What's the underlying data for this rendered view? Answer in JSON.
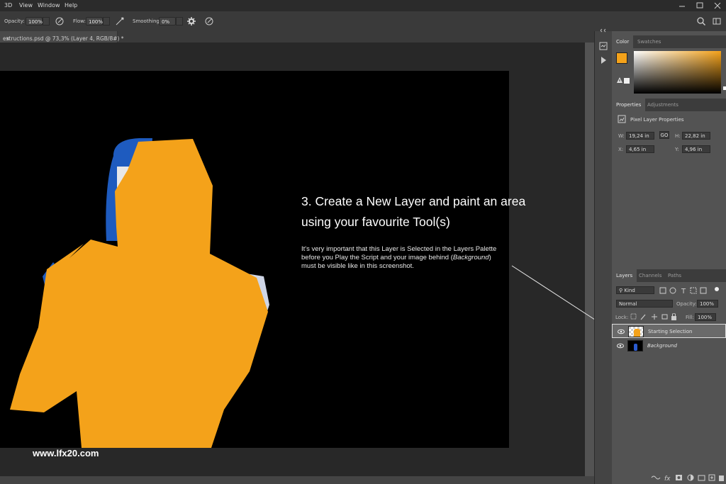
{
  "menubar": {
    "items": [
      "3D",
      "View",
      "Window",
      "Help"
    ]
  },
  "options": {
    "opacity_label": "Opacity:",
    "opacity_value": "100%",
    "flow_label": "Flow:",
    "flow_value": "100%",
    "smoothing_label": "Smoothing:",
    "smoothing_value": "0%"
  },
  "document": {
    "tab_title": "estructions.psd @ 73,3% (Layer 4, RGB/8#) *",
    "close": "×"
  },
  "color_panel": {
    "tabs": [
      "Color",
      "Swatches"
    ],
    "foreground": "#f4a21a",
    "background": "#ffffff"
  },
  "properties_panel": {
    "tabs": [
      "Properties",
      "Adjustments"
    ],
    "title": "Pixel Layer Properties",
    "w_label": "W:",
    "w_value": "19,24 in",
    "go_label": "GO",
    "h_label": "H:",
    "h_value": "22,82 in",
    "x_label": "X:",
    "x_value": "4,65 in",
    "y_label": "Y:",
    "y_value": "4,96 in"
  },
  "layers_panel": {
    "tabs": [
      "Layers",
      "Channels",
      "Paths"
    ],
    "kind_label": "Kind",
    "blend_mode": "Normal",
    "opacity_label": "Opacity:",
    "opacity_value": "100%",
    "lock_label": "Lock:",
    "fill_label": "Fill:",
    "fill_value": "100%",
    "layers": [
      {
        "name": "Starting Selection",
        "selected": true
      },
      {
        "name": "Background",
        "selected": false
      }
    ]
  },
  "overlay": {
    "heading_line1": "3. Create a New Layer and paint an area",
    "heading_line2": "using your favourite Tool(s)",
    "body_line1": "It's very important that this Layer is Selected in the Layers Palette",
    "body_line2a": "before you Play the Script and your image behind (",
    "body_line2b": "Background",
    "body_line2c": ")",
    "body_line3": "must be visible like in this screenshot.",
    "watermark": "www.lfx20.com"
  },
  "colors": {
    "accent_orange": "#f4a21a",
    "canvas": "#000000",
    "ui_dark": "#535353"
  }
}
